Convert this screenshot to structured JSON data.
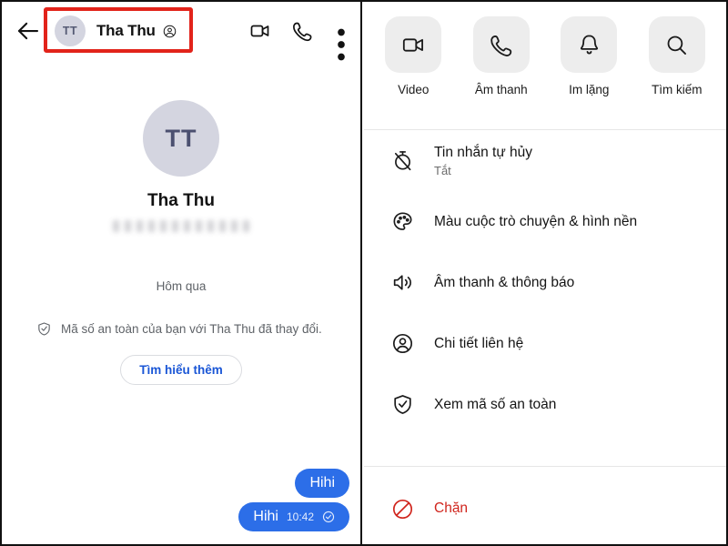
{
  "left_panel": {
    "header": {
      "back_icon": "back-arrow-icon",
      "avatar_initials": "TT",
      "peer_name": "Tha Thu",
      "verified_icon": "verified-account-icon",
      "video_icon": "video-camera-icon",
      "call_icon": "phone-icon",
      "more_icon": "three-dots-vertical-icon"
    },
    "profile": {
      "avatar_initials": "TT",
      "name": "Tha Thu",
      "phone_blurred": ""
    },
    "day_label": "Hôm qua",
    "system_note": {
      "icon": "shield-check-icon",
      "text": "Mã số an toàn của bạn với Tha Thu đã thay đổi.",
      "button_label": "Tìm hiểu thêm"
    },
    "messages": [
      {
        "text": "Hihi",
        "time": "",
        "status": ""
      },
      {
        "text": "Hihi",
        "time": "10:42",
        "status": "sent-check-icon"
      }
    ]
  },
  "right_panel": {
    "actions": [
      {
        "icon": "video-camera-icon",
        "label": "Video"
      },
      {
        "icon": "phone-icon",
        "label": "Âm thanh"
      },
      {
        "icon": "bell-icon",
        "label": "Im lặng"
      },
      {
        "icon": "search-icon",
        "label": "Tìm kiếm"
      }
    ],
    "settings": [
      {
        "icon": "timer-off-icon",
        "title": "Tin nhắn tự hủy",
        "subtitle": "Tắt"
      },
      {
        "icon": "palette-icon",
        "title": "Màu cuộc trò chuyện & hình nền",
        "subtitle": ""
      },
      {
        "icon": "speaker-icon",
        "title": "Âm thanh & thông báo",
        "subtitle": ""
      },
      {
        "icon": "person-circle-icon",
        "title": "Chi tiết liên hệ",
        "subtitle": ""
      },
      {
        "icon": "shield-check-icon",
        "title": "Xem mã số an toàn",
        "subtitle": ""
      }
    ],
    "block": {
      "icon": "block-circle-icon",
      "label": "Chặn"
    }
  },
  "annotations": {
    "highlight_color": "#e2231a",
    "boxes": [
      {
        "name": "header-peer-highlight"
      },
      {
        "name": "block-row-highlight"
      }
    ]
  },
  "colors": {
    "bubble_blue": "#2c6ee8",
    "link_blue": "#1a56d6",
    "danger_red": "#d0241c",
    "avatar_bg": "#d4d5e0",
    "tile_bg": "#ededed"
  }
}
